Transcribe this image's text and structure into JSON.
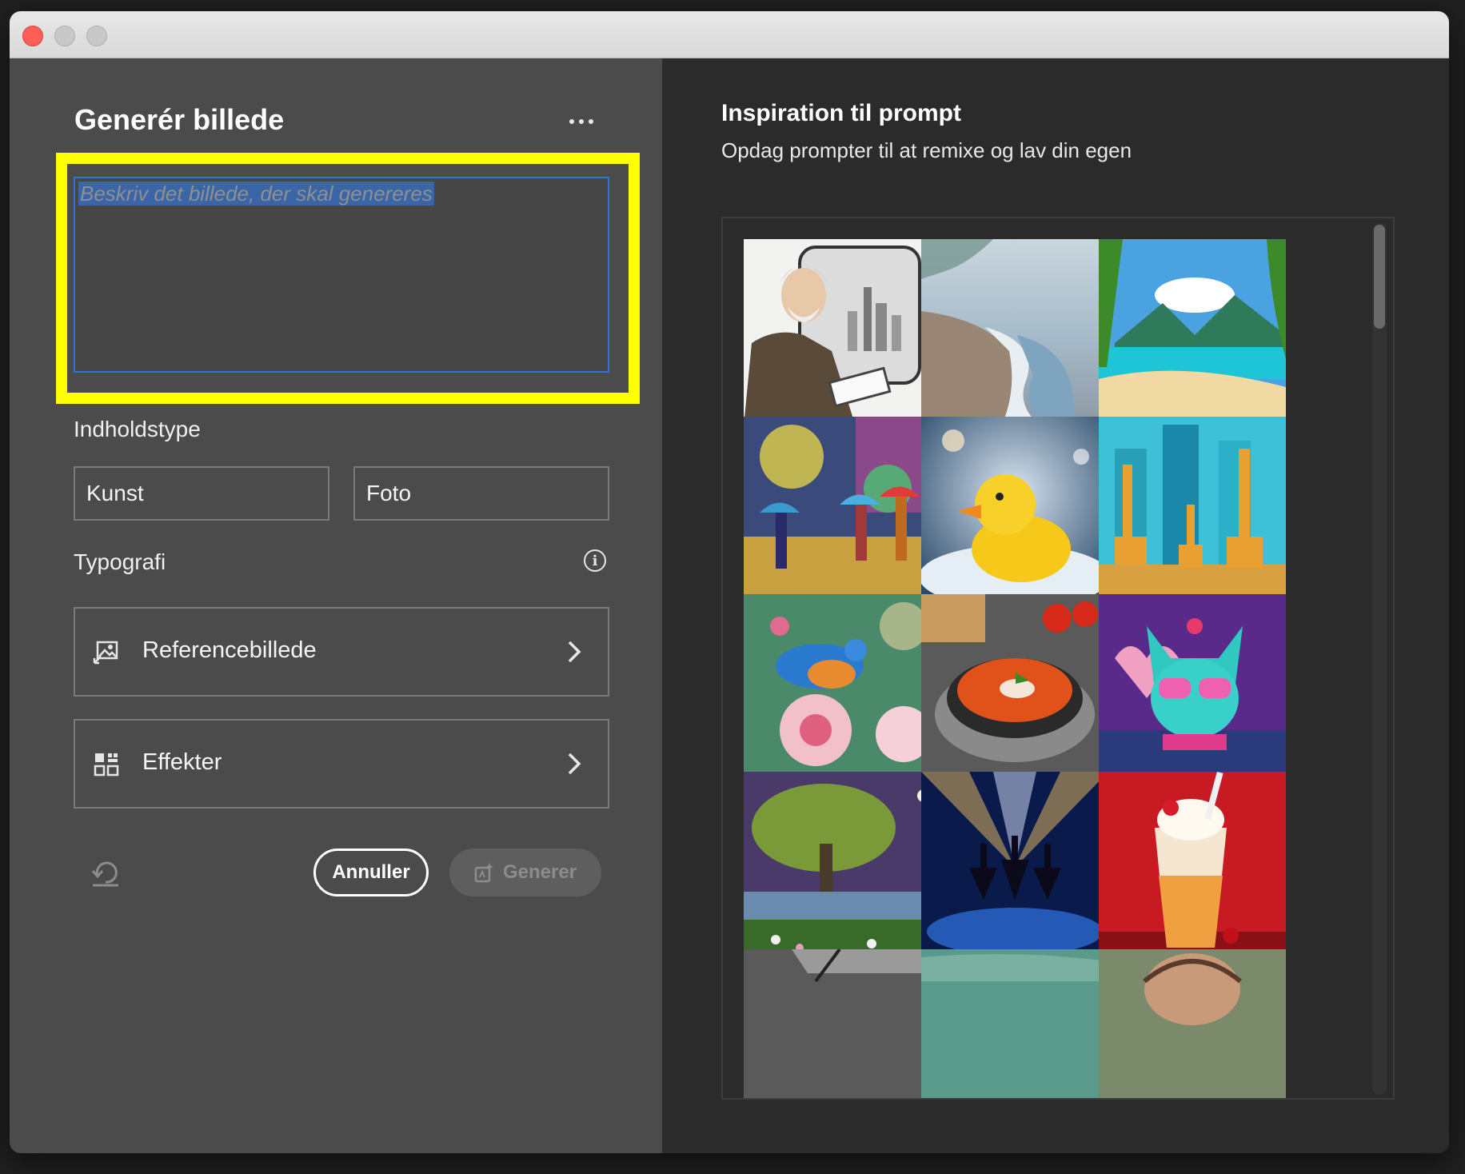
{
  "left_panel": {
    "title": "Generér billede",
    "more_icon": "more-horizontal-icon",
    "prompt": {
      "placeholder": "Beskriv det billede, der skal genereres",
      "value": ""
    },
    "content_type": {
      "label": "Indholdstype",
      "options": [
        "Kunst",
        "Foto"
      ]
    },
    "typography": {
      "label": "Typografi",
      "info_icon": "info-icon"
    },
    "reference_image": {
      "label": "Referencebillede",
      "icon": "image-reference-icon"
    },
    "effects": {
      "label": "Effekter",
      "icon": "effects-grid-icon"
    },
    "actions": {
      "reset_icon": "reset-icon",
      "cancel_label": "Annuller",
      "generate_label": "Generer",
      "generate_icon": "generate-icon"
    }
  },
  "right_panel": {
    "title": "Inspiration til prompt",
    "subtitle": "Opdag prompter til at remixe og lav din egen"
  },
  "colors": {
    "highlight": "#ffff00",
    "focus_border": "#2f73d9",
    "left_bg": "#4b4b4b",
    "right_bg": "#2b2b2b"
  }
}
